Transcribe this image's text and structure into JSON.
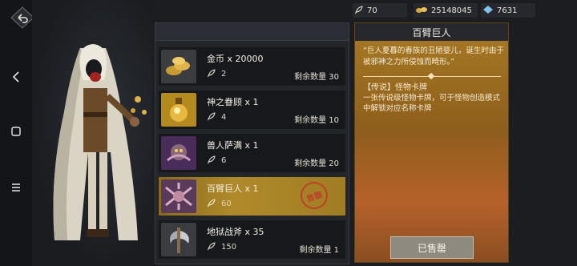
{
  "resources": [
    {
      "icon": "feather-icon",
      "value": "70"
    },
    {
      "icon": "gold-coins-icon",
      "value": "25148045"
    },
    {
      "icon": "crystal-icon",
      "value": "7631"
    }
  ],
  "items": [
    {
      "name": "金币 x 20000",
      "price": "2",
      "stock": "剩余数量 30",
      "icon": "gold-coins-icon",
      "selected": false
    },
    {
      "name": "神之眷顾 x 1",
      "price": "4",
      "stock": "剩余数量 10",
      "icon": "potion-icon",
      "selected": false
    },
    {
      "name": "兽人萨满 x 1",
      "price": "6",
      "stock": "剩余数量 20",
      "icon": "monster-card-icon",
      "selected": false
    },
    {
      "name": "百臂巨人 x 1",
      "price": "60",
      "stock": "",
      "icon": "monster-card-icon",
      "selected": true,
      "stamp": "售罄"
    },
    {
      "name": "地狱战斧 x 35",
      "price": "150",
      "stock": "剩余数量 1",
      "icon": "battle-axe-icon",
      "selected": false
    }
  ],
  "detail": {
    "title": "百臂巨人",
    "quote": "“巨人夏暮的春族的丑陋婴儿，诞生时由于被邪神之力所侵蚀而畸形。”",
    "type": "【传说】怪物卡牌",
    "desc": "一张传说级怪物卡牌，可于怪物创造模式中解锁对应名称卡牌",
    "button": "已售罄"
  },
  "colors": {
    "accent_gold": "#b08a2a",
    "stamp_red": "#c0392b"
  }
}
